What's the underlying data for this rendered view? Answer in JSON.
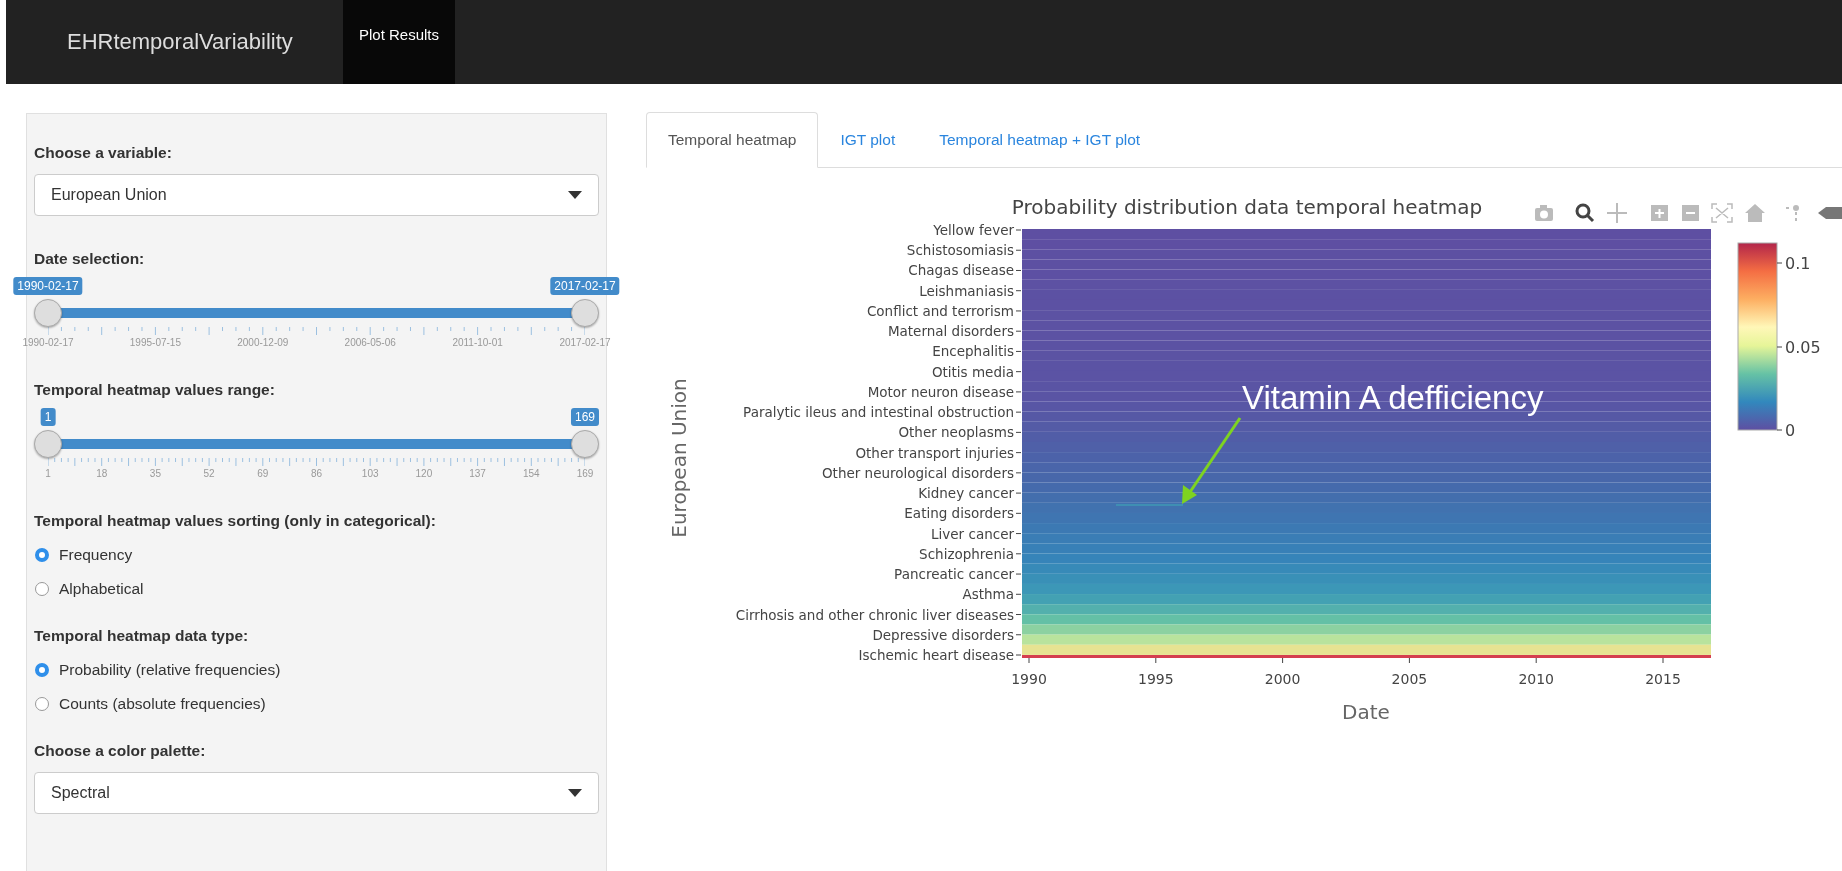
{
  "navbar": {
    "brand": "EHRtemporalVariability",
    "items": [
      {
        "label": "Plot Results",
        "selected": true
      }
    ]
  },
  "sidebar": [
    {
      "kind": "select",
      "label": "Choose a variable:",
      "value": "European Union"
    },
    {
      "kind": "slider",
      "label": "Date selection:",
      "handles": [
        {
          "label": "1990-02-17",
          "level": 0
        },
        {
          "label": "2017-02-17",
          "level": 1
        }
      ],
      "ticks": [
        "1990-02-17",
        "1995-07-15",
        "2000-12-09",
        "2006-05-06",
        "2011-10-01",
        "2017-02-17"
      ]
    },
    {
      "kind": "slider",
      "label": "Temporal heatmap values range:",
      "handles": [
        {
          "label": "1",
          "level": 0
        },
        {
          "label": "169",
          "level": 1
        }
      ],
      "ticks": [
        "1",
        "18",
        "35",
        "52",
        "69",
        "86",
        "103",
        "120",
        "137",
        "154",
        "169"
      ]
    },
    {
      "kind": "radio",
      "label": "Temporal heatmap values sorting (only in categorical):",
      "options": [
        {
          "label": "Frequency",
          "selected": true
        },
        {
          "label": "Alphabetical",
          "selected": false
        }
      ]
    },
    {
      "kind": "radio",
      "label": "Temporal heatmap data type:",
      "options": [
        {
          "label": "Probability (relative frequencies)",
          "selected": true
        },
        {
          "label": "Counts (absolute frequencies)",
          "selected": false
        }
      ]
    },
    {
      "kind": "select",
      "label": "Choose a color palette:",
      "value": "Spectral"
    }
  ],
  "tabs": [
    {
      "label": "Temporal heatmap",
      "selected": true
    },
    {
      "label": "IGT plot",
      "selected": false
    },
    {
      "label": "Temporal heatmap + IGT plot",
      "selected": false
    }
  ],
  "plot": {
    "title": "Probability distribution data temporal heatmap",
    "ylabel": "European Union",
    "xlabel": "Date",
    "y_labels": [
      "Yellow fever",
      "Schistosomiasis",
      "Chagas disease",
      "Leishmaniasis",
      "Conflict and terrorism",
      "Maternal disorders",
      "Encephalitis",
      "Otitis media",
      "Motor neuron disease",
      "Paralytic ileus and intestinal obstruction",
      "Other neoplasms",
      "Other transport injuries",
      "Other neurological disorders",
      "Kidney cancer",
      "Eating disorders",
      "Liver cancer",
      "Schizophrenia",
      "Pancreatic cancer",
      "Asthma",
      "Cirrhosis and other chronic liver diseases",
      "Depressive disorders",
      "Ischemic heart disease"
    ],
    "x_ticks": [
      "1990",
      "1995",
      "2000",
      "2005",
      "2010",
      "2015"
    ],
    "colorbar_ticks": [
      "0.1",
      "0.05",
      "0"
    ],
    "annotation": "Vitamin A defficiency"
  }
}
